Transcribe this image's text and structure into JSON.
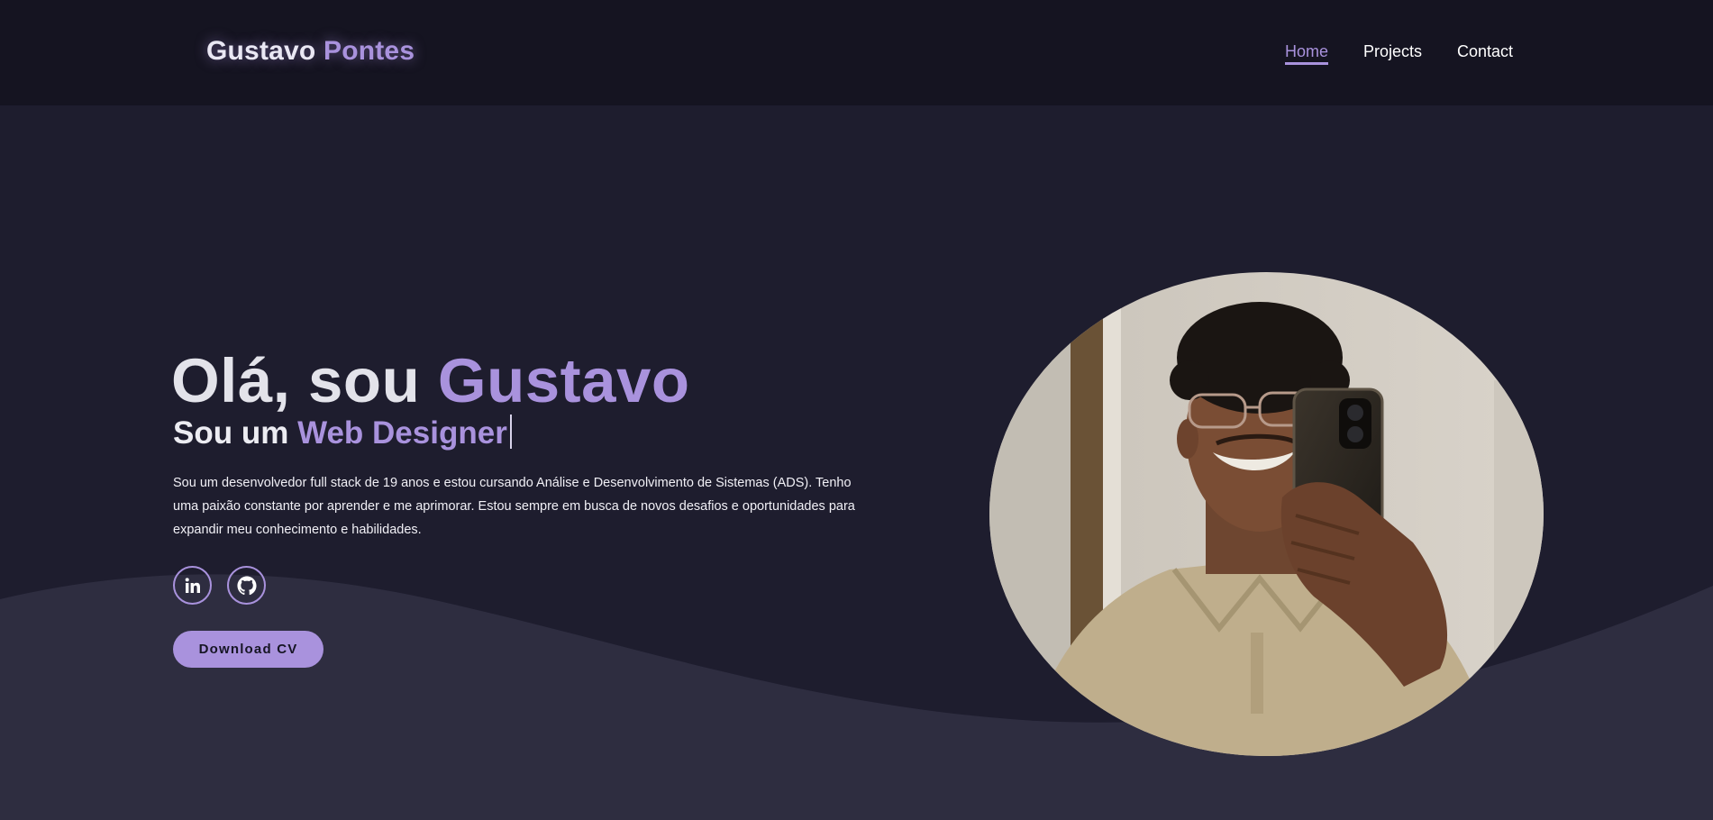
{
  "header": {
    "logo_first": "Gustavo",
    "logo_second": "Pontes",
    "nav": [
      {
        "label": "Home",
        "active": true
      },
      {
        "label": "Projects",
        "active": false
      },
      {
        "label": "Contact",
        "active": false
      }
    ]
  },
  "hero": {
    "title_prefix": "Olá, sou",
    "title_name": "Gustavo",
    "subtitle_prefix": "Sou um",
    "subtitle_role": "Web Designer",
    "description": "Sou um desenvolvedor full stack de 19 anos e estou cursando Análise e Desenvolvimento de Sistemas (ADS). Tenho uma paixão constante por aprender e me aprimorar. Estou sempre em busca de novos desafios e oportunidades para expandir meu conhecimento e habilidades.",
    "social": [
      {
        "icon": "linkedin-icon"
      },
      {
        "icon": "github-icon"
      }
    ],
    "cv_button": "Download CV",
    "photo_icon": "profile-photo"
  },
  "colors": {
    "accent": "#a992dd",
    "background": "#1e1d2e",
    "header": "#151421",
    "wave": "#2e2d40"
  }
}
